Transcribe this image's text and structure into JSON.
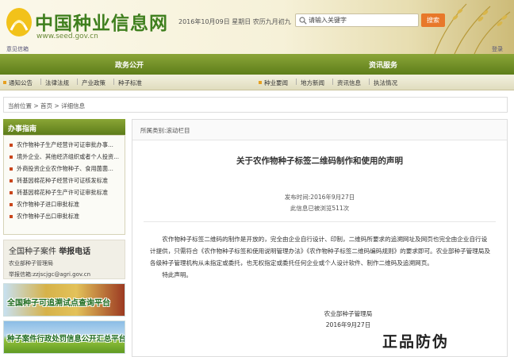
{
  "header": {
    "site_title": "中国种业信息网",
    "site_url": "www.seed.gov.cn",
    "date_line": "2016年10月09日 星期日 农历九月初九",
    "search_placeholder": "请输入关键字",
    "search_button": "搜索",
    "util_left": "意见信箱",
    "util_right": "登录"
  },
  "main_nav": {
    "left": "政务公开",
    "right": "资讯服务"
  },
  "sub_nav": {
    "left": [
      "通知公告",
      "法律法规",
      "产业政策",
      "种子标准"
    ],
    "right": [
      "种业要闻",
      "地方新闻",
      "资讯信息",
      "执法情况"
    ]
  },
  "breadcrumb": "当前位置 > 首页 > 详细信息",
  "sidebar": {
    "guide_title": "办事指南",
    "guide_items": [
      "农作物种子生产经营许可证审批办事...",
      "境外企业、其他经济组织或者个人投资...",
      "外商投资企业农作物种子、食用菌菌...",
      "转基因棉花种子经营许可证核发标准",
      "转基因棉花种子生产许可证审批标准",
      "农作物种子进口审批标准",
      "农作物种子出口审批标准"
    ],
    "report_title": "全国种子案件",
    "report_title_bold": "举报电话",
    "report_sub": "农业部种子管理局",
    "report_mail": "举报信箱:zzjscjgc@agri.gov.cn",
    "banner1_text": "全国种子可追溯试点查询平台",
    "banner2_text": "种子案件行政处罚信息公开汇总平台"
  },
  "article": {
    "category": "所属类别:滚动栏目",
    "title": "关于农作物种子标签二维码制作和使用的声明",
    "publish_time": "发布时间:2016年9月27日",
    "views": "此信息已被浏览511次",
    "paragraph": "农作物种子标签二维码的制作是开放的，完全由企业自行设计、印制，二维码所要求的追溯网址及网页也完全由企业自行设计提供，只需符合《农作物种子标签和使用说明管理办法》《农作物种子标签二维码编码规则》的要求即可。农业部种子管理局及各级种子管理机构从未指定或委托，也无权指定或委托任何企业或个人设计软件、制作二维码及追溯网页。",
    "closing": "特此声明。",
    "signer": "农业部种子管理局",
    "sign_date": "2016年9月27日"
  },
  "watermark": "正品防伪",
  "colors": {
    "nav_green": "#6b8a20",
    "title_green": "#3f7f1e",
    "search_orange": "#e8782a"
  }
}
